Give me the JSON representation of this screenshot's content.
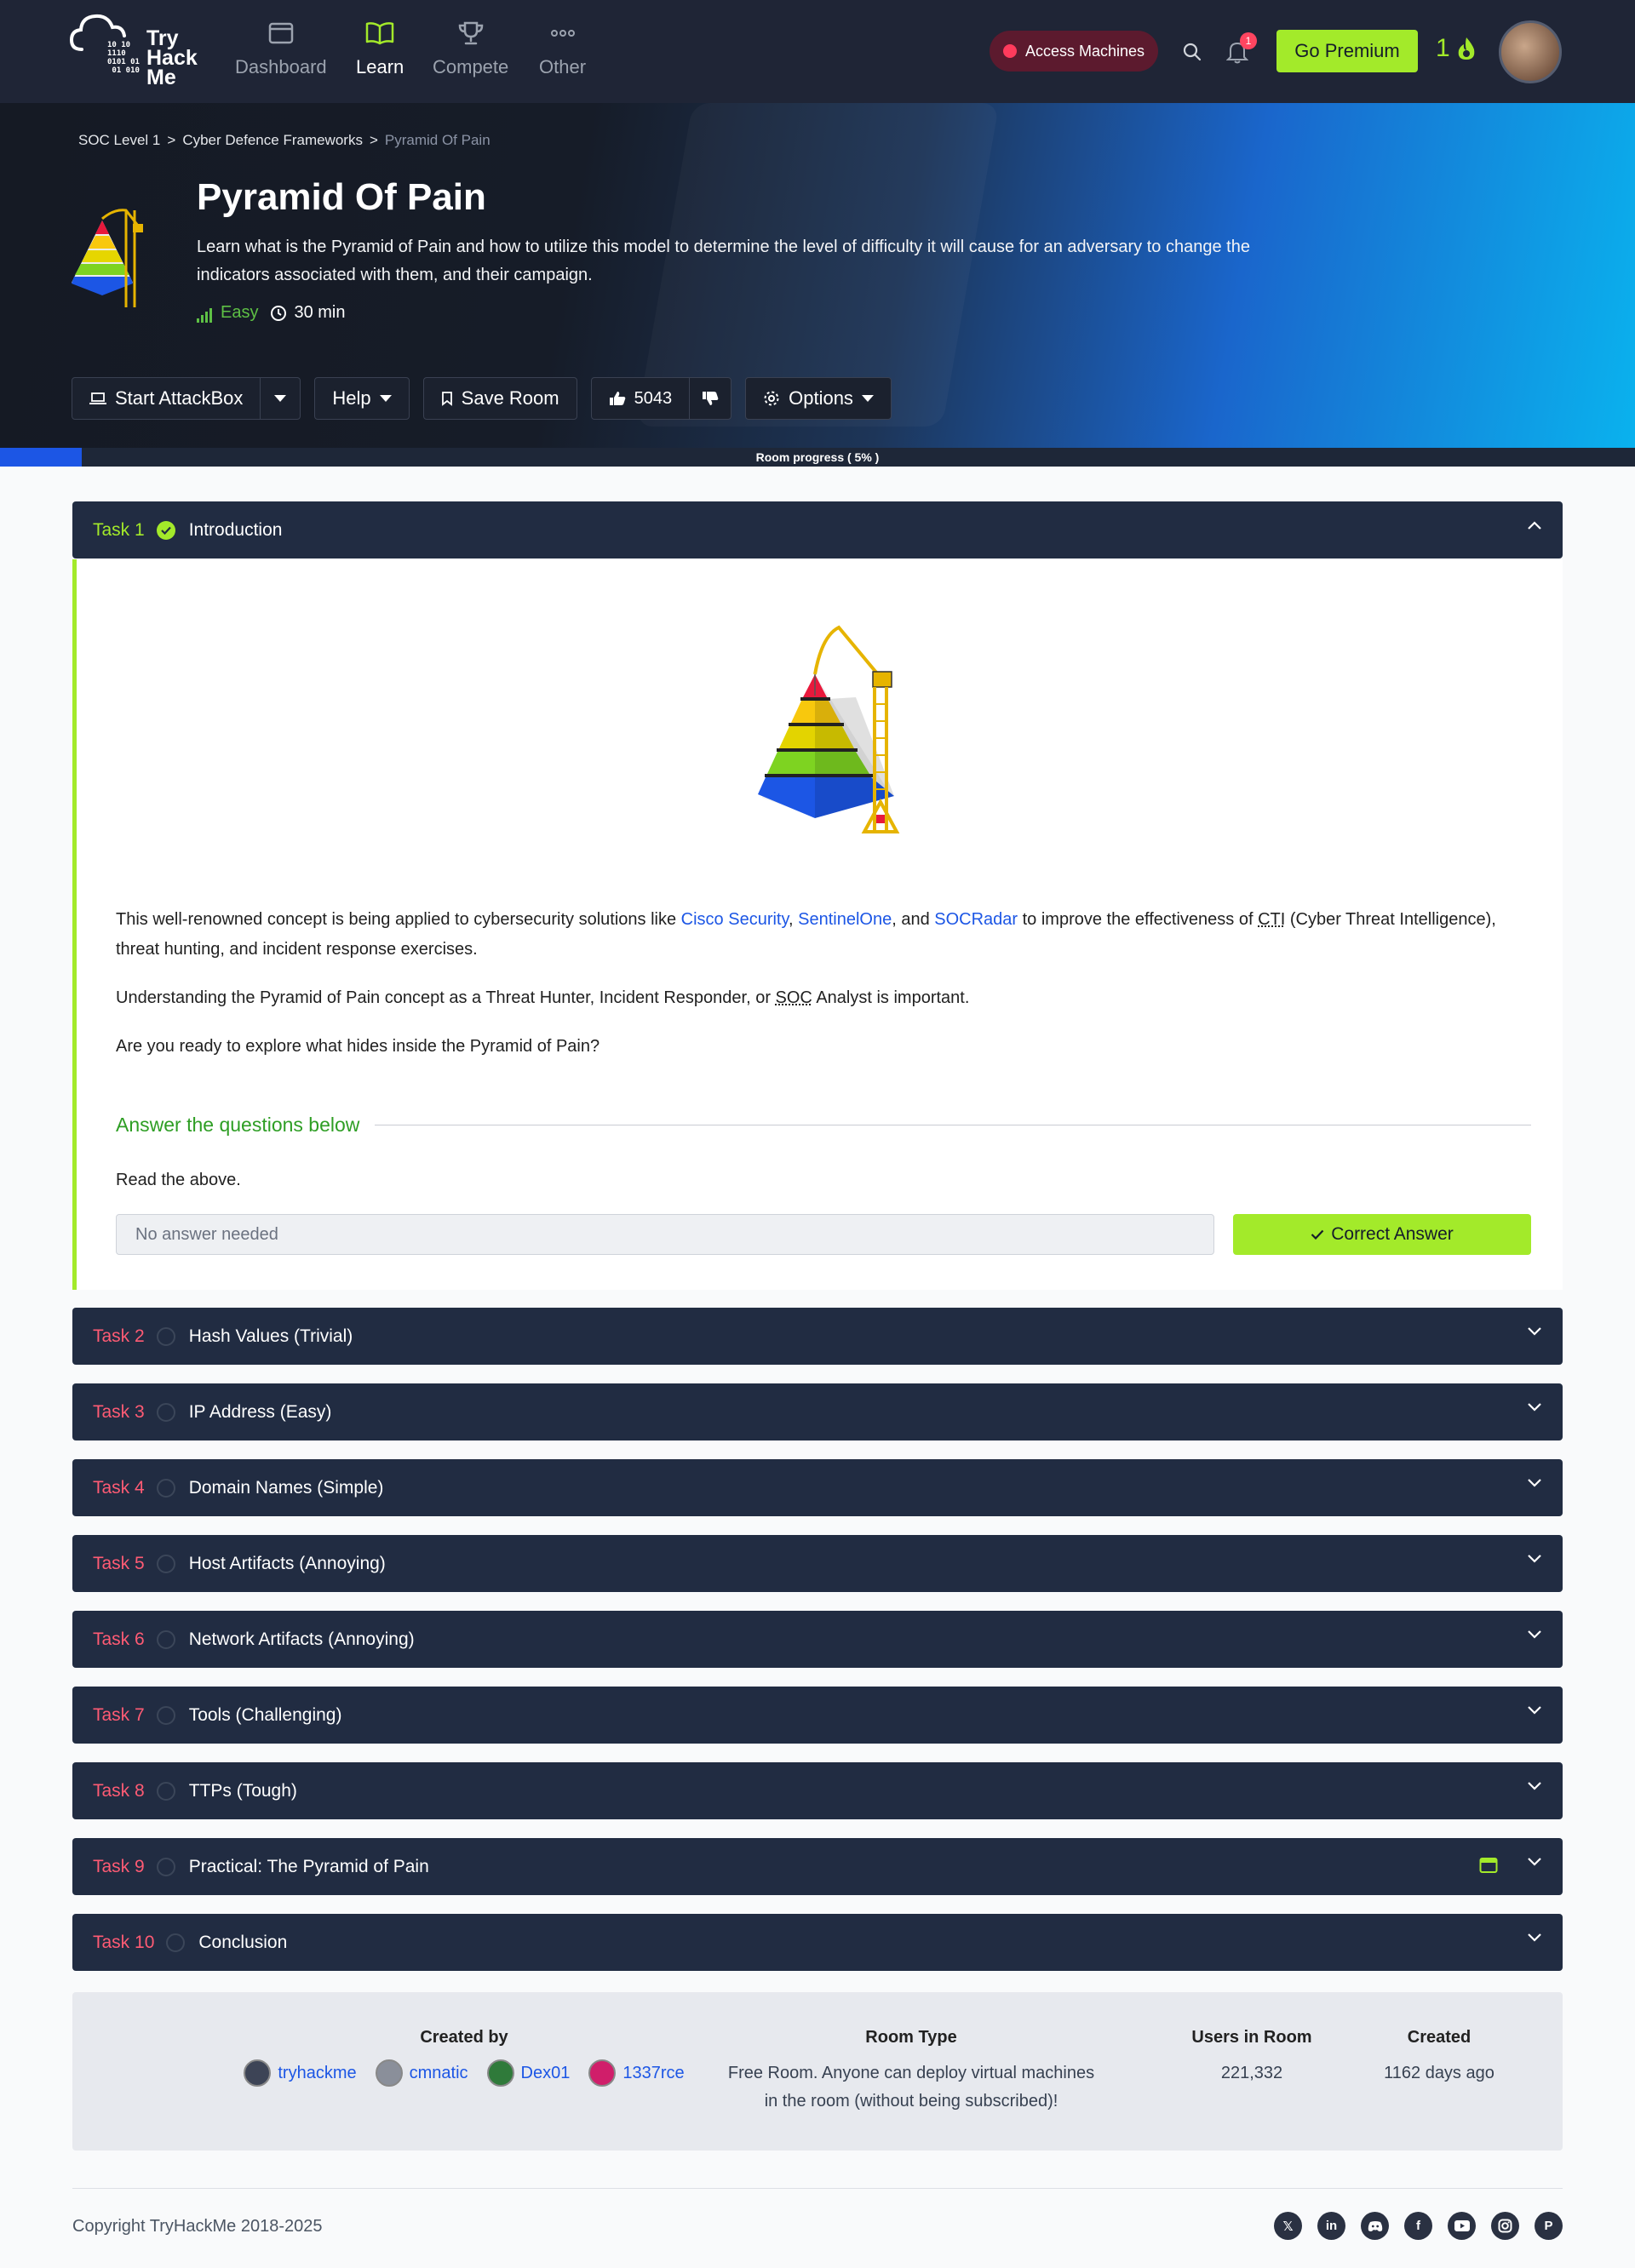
{
  "nav": {
    "logo_text_1": "Try",
    "logo_text_2": "Hack",
    "logo_text_3": "Me",
    "items": [
      {
        "label": "Dashboard",
        "icon": "window-icon"
      },
      {
        "label": "Learn",
        "icon": "book-icon",
        "active": true
      },
      {
        "label": "Compete",
        "icon": "trophy-icon"
      },
      {
        "label": "Other",
        "icon": "more-icon"
      }
    ],
    "access_machines": "Access Machines",
    "notification_count": "1",
    "go_premium": "Go Premium",
    "streak": "1",
    "accent": "#a3ea2a"
  },
  "hero": {
    "breadcrumb": [
      "SOC Level 1",
      ">",
      "Cyber Defence Frameworks",
      ">",
      "Pyramid Of Pain"
    ],
    "title": "Pyramid Of Pain",
    "description": "Learn what is the Pyramid of Pain and how to utilize this model to determine the level of difficulty it will cause for an adversary to change the indicators associated with them, and their campaign.",
    "difficulty": "Easy",
    "duration": "30 min"
  },
  "toolbar": {
    "start_attackbox": "Start AttackBox",
    "help": "Help",
    "save_room": "Save Room",
    "likes": "5043",
    "options": "Options"
  },
  "progress": {
    "label": "Room progress ( 5% )",
    "fraction": 0.05
  },
  "task1": {
    "num": "Task 1",
    "title": "Introduction",
    "para1_a": "This well-renowned concept is being applied to cybersecurity solutions like ",
    "link1": "Cisco Security",
    "sep1": ", ",
    "link2": "SentinelOne",
    "sep2": ", and ",
    "link3": "SOCRadar",
    "para1_b": " to improve the effectiveness of ",
    "cti": "CTI",
    "para1_c": " (Cyber Threat Intelligence), threat hunting, and incident response exercises.",
    "para2_a": "Understanding the Pyramid of Pain concept as a Threat Hunter, Incident Responder, or ",
    "soc": "SOC",
    "para2_b": " Analyst is important.",
    "para3": "Are you ready to explore what hides inside the Pyramid of Pain?",
    "answer_title": "Answer the questions below",
    "question": "Read the above.",
    "answer_placeholder": "No answer needed",
    "correct": "Correct Answer"
  },
  "tasks": [
    {
      "num": "Task 2",
      "title": "Hash Values (Trivial)"
    },
    {
      "num": "Task 3",
      "title": "IP Address (Easy)"
    },
    {
      "num": "Task 4",
      "title": "Domain Names (Simple)"
    },
    {
      "num": "Task 5",
      "title": "Host Artifacts (Annoying)"
    },
    {
      "num": "Task 6",
      "title": "Network Artifacts (Annoying)"
    },
    {
      "num": "Task 7",
      "title": "Tools (Challenging)"
    },
    {
      "num": "Task 8",
      "title": "TTPs (Tough)"
    },
    {
      "num": "Task 9",
      "title": "Practical: The Pyramid of Pain"
    },
    {
      "num": "Task 10",
      "title": "Conclusion"
    }
  ],
  "info": {
    "created_by": "Created by",
    "creators": [
      "tryhackme",
      "cmnatic",
      "Dex01",
      "1337rce"
    ],
    "room_type_h": "Room Type",
    "room_type_1": "Free Room. Anyone can deploy virtual machines",
    "room_type_2": "in the room (without being subscribed)!",
    "users_h": "Users in Room",
    "users": "221,332",
    "created_h": "Created",
    "created": "1162 days ago"
  },
  "footer": {
    "copyright": "Copyright TryHackMe 2018-2025",
    "socials": [
      "x-icon",
      "linkedin-icon",
      "discord-icon",
      "facebook-icon",
      "youtube-icon",
      "instagram-icon",
      "pinterest-icon"
    ]
  }
}
